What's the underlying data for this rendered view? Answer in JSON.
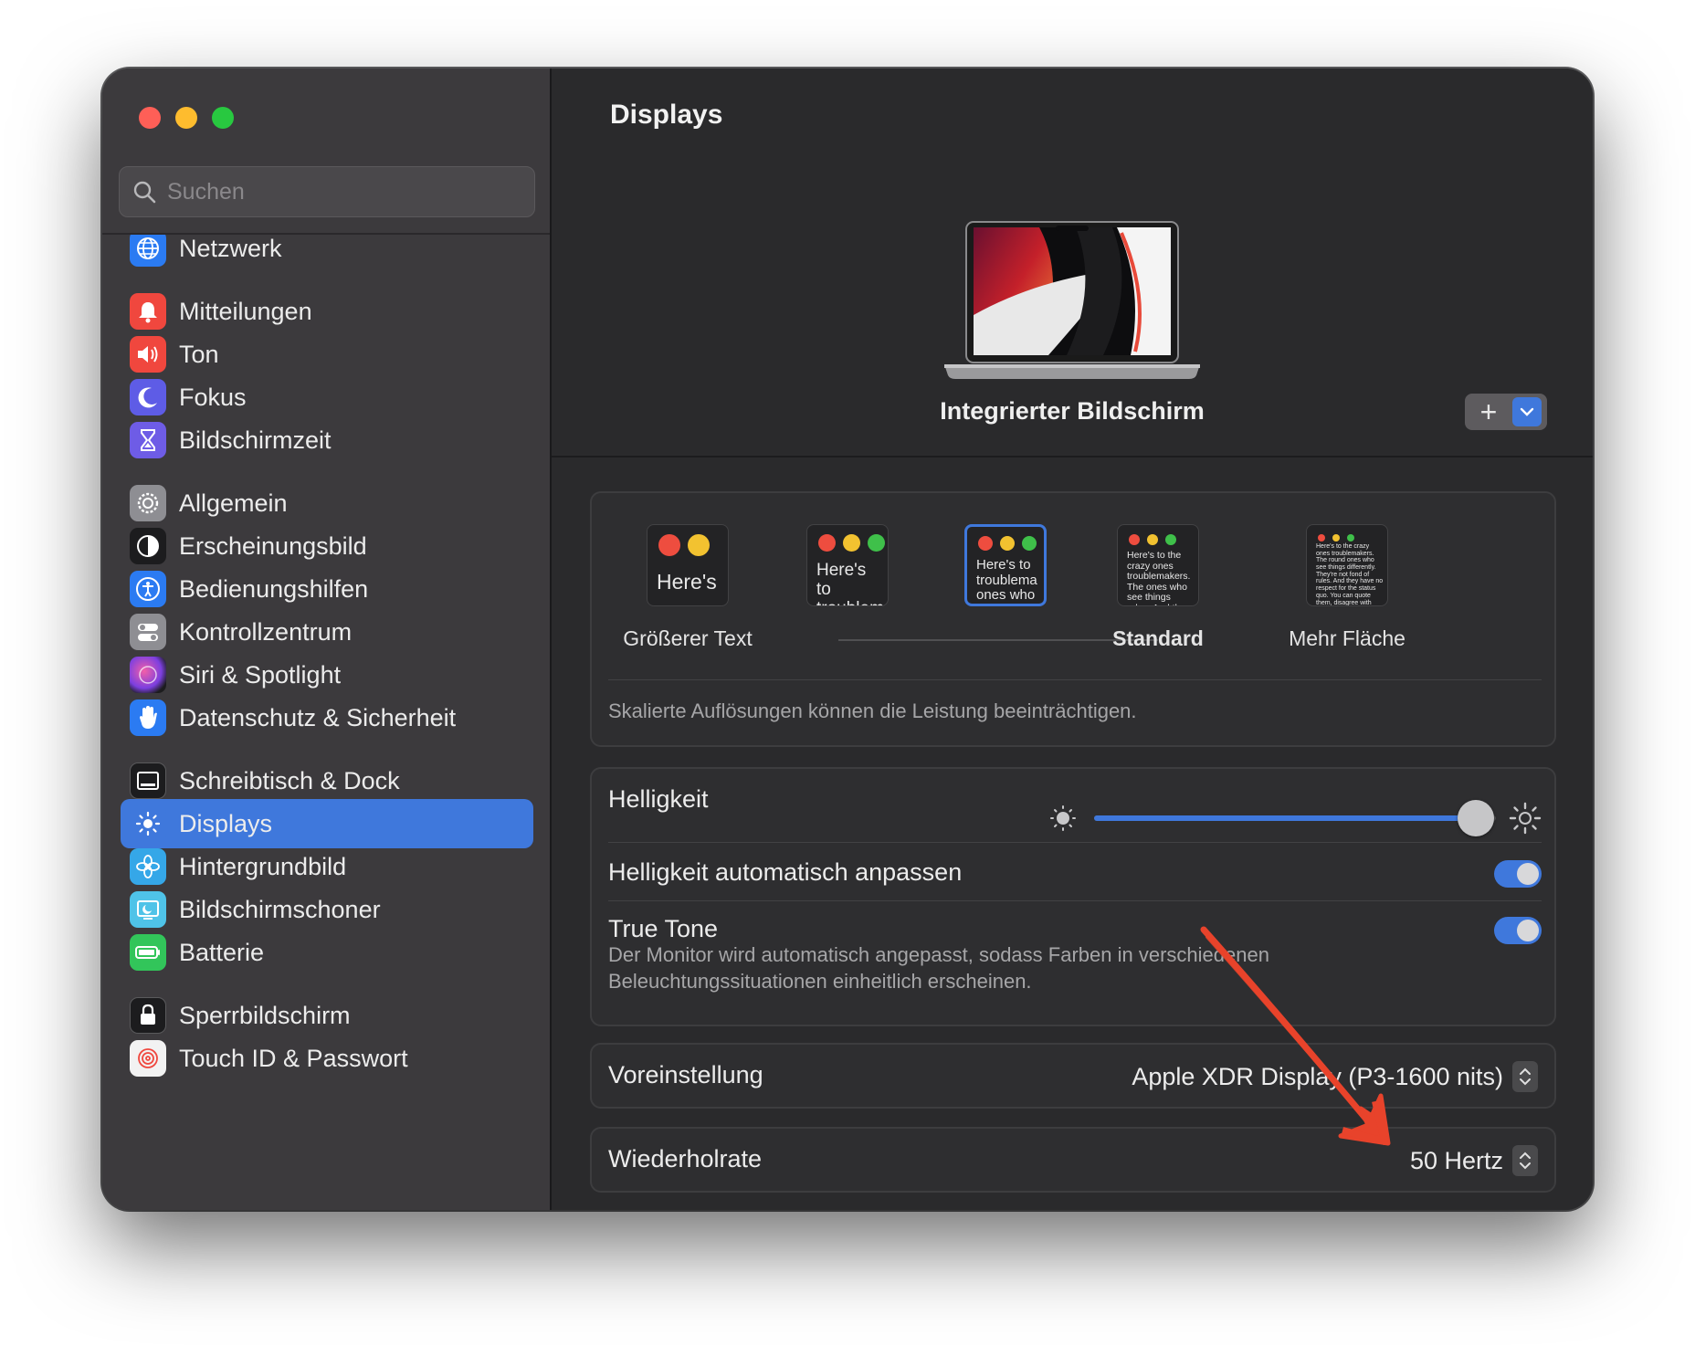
{
  "window": {
    "controls": [
      "close",
      "minimize",
      "zoom"
    ]
  },
  "sidebar": {
    "search_placeholder": "Suchen",
    "items": [
      {
        "label": "Netzwerk",
        "icon": "globe-icon",
        "color": "#2b7bf2"
      },
      {
        "label": "Mitteilungen",
        "icon": "bell-icon",
        "color": "#f0473e"
      },
      {
        "label": "Ton",
        "icon": "speaker-icon",
        "color": "#f0473e"
      },
      {
        "label": "Fokus",
        "icon": "moon-icon",
        "color": "#5e5ce6"
      },
      {
        "label": "Bildschirmzeit",
        "icon": "hourglass-icon",
        "color": "#6e5ce6"
      },
      {
        "label": "Allgemein",
        "icon": "gear-icon",
        "color": "#8e8e93"
      },
      {
        "label": "Erscheinungsbild",
        "icon": "appearance-icon",
        "color": "#1c1c1e"
      },
      {
        "label": "Bedienungshilfen",
        "icon": "accessibility-icon",
        "color": "#2b7bf2"
      },
      {
        "label": "Kontrollzentrum",
        "icon": "toggles-icon",
        "color": "#8e8e93"
      },
      {
        "label": "Siri & Spotlight",
        "icon": "siri-icon",
        "color": "#b24bd8"
      },
      {
        "label": "Datenschutz & Sicherheit",
        "icon": "hand-icon",
        "color": "#2b7bf2"
      },
      {
        "label": "Schreibtisch & Dock",
        "icon": "dock-icon",
        "color": "#1c1c1e"
      },
      {
        "label": "Displays",
        "icon": "sun-icon",
        "color": "#2b7bf2",
        "active": true
      },
      {
        "label": "Hintergrundbild",
        "icon": "flower-icon",
        "color": "#35a7e8"
      },
      {
        "label": "Bildschirmschoner",
        "icon": "screensaver-icon",
        "color": "#4fc3e8"
      },
      {
        "label": "Batterie",
        "icon": "battery-icon",
        "color": "#32c55a"
      },
      {
        "label": "Sperrbildschirm",
        "icon": "lock-icon",
        "color": "#1c1c1e"
      },
      {
        "label": "Touch ID & Passwort",
        "icon": "fingerprint-icon",
        "color": "#f2f2f2"
      }
    ]
  },
  "main": {
    "title": "Displays",
    "display_name": "Integrierter Bildschirm",
    "add_button_label": "+",
    "resolution": {
      "options": [
        {
          "label": "Größerer Text",
          "sample": "Here's",
          "bold": false
        },
        {
          "label": "",
          "sample": "Here's to troublem",
          "bold": false
        },
        {
          "label": "",
          "sample": "Here's to troublema ones who",
          "bold": false,
          "selected": true
        },
        {
          "label": "Standard",
          "sample": "Here's to the crazy ones troublemakers. The ones who see things rules. And they",
          "bold": true
        },
        {
          "label": "Mehr Fläche",
          "sample": "Here's to the crazy ones troublemakers. The round ones who see things differently. They're not fond of rules. And they have no respect for the status quo. You can quote them, disagree with them. About the only thing Because they change things.",
          "bold": false
        }
      ],
      "note": "Skalierte Auflösungen können die Leistung beeinträchtigen."
    },
    "brightness": {
      "label": "Helligkeit",
      "level": 0.95,
      "auto_label": "Helligkeit automatisch anpassen",
      "auto_enabled": true,
      "true_tone_label": "True Tone",
      "true_tone_desc": "Der Monitor wird automatisch angepasst, sodass Farben in verschiedenen Beleuchtungssituationen einheitlich erscheinen.",
      "true_tone_enabled": true
    },
    "preset": {
      "label": "Voreinstellung",
      "value": "Apple XDR Display (P3-1600 nits)"
    },
    "refresh": {
      "label": "Wiederholrate",
      "value": "50 Hertz"
    }
  },
  "colors": {
    "accent": "#3f78dc",
    "annotation": "#e8432b"
  }
}
